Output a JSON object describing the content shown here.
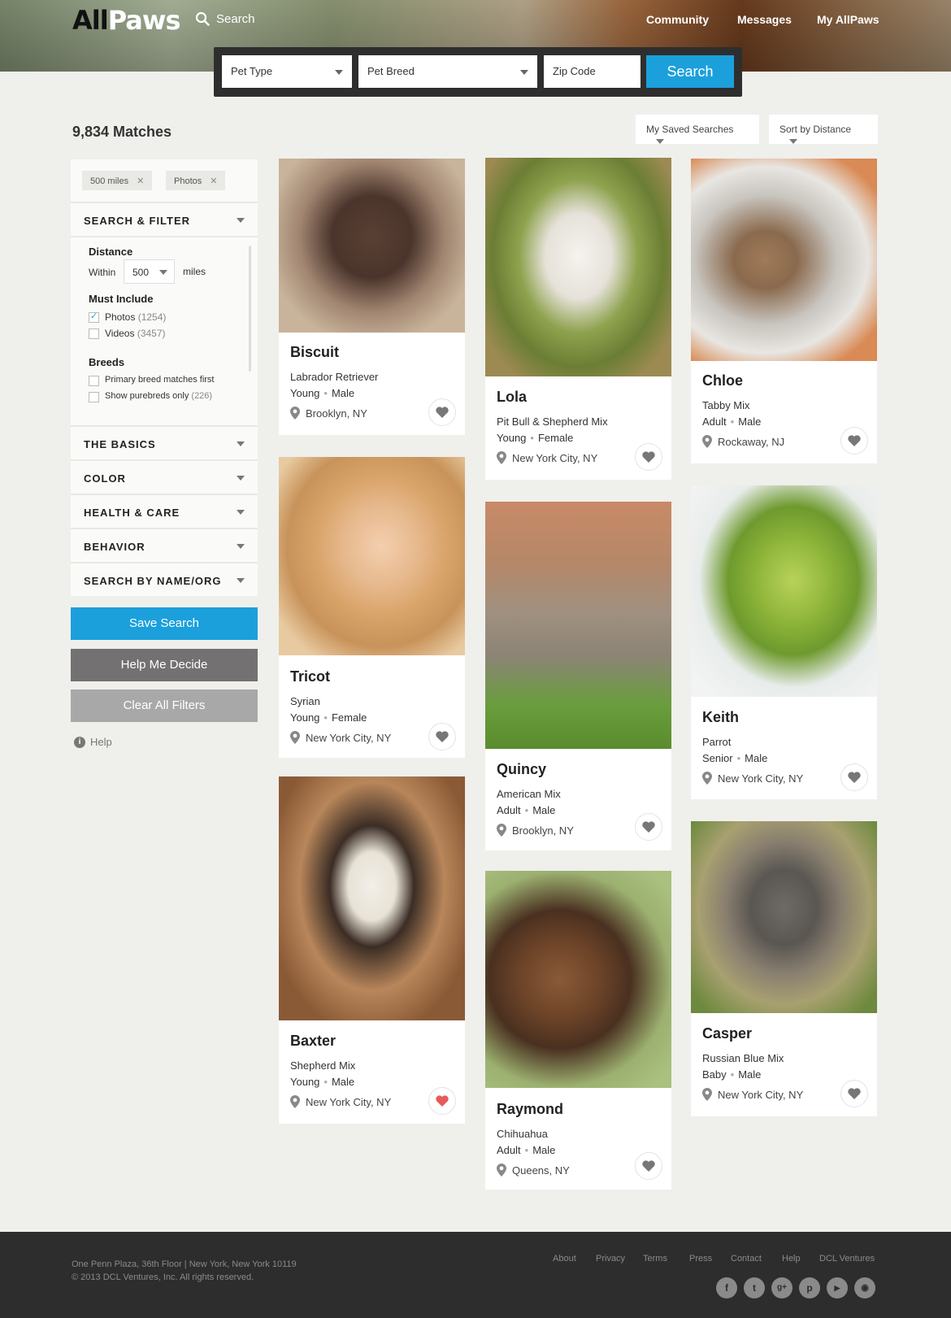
{
  "header": {
    "logo_part1": "All",
    "logo_part2": "Paws",
    "search_label": "Search",
    "nav": [
      "Community",
      "Messages",
      "My AllPaws"
    ]
  },
  "searchbar": {
    "pet_type": "Pet Type",
    "pet_breed": "Pet Breed",
    "zip_placeholder": "Zip Code",
    "search_button": "Search"
  },
  "results": {
    "matches": "9,834 Matches",
    "saved_searches": "My Saved Searches",
    "sort": "Sort by Distance"
  },
  "sidebar": {
    "chips": [
      "500 miles",
      "Photos"
    ],
    "search_filter": "SEARCH & FILTER",
    "distance_label": "Distance",
    "within": "Within",
    "distance_value": "500",
    "miles": "miles",
    "must_include": "Must Include",
    "photos": "Photos",
    "photos_count": "(1254)",
    "videos": "Videos",
    "videos_count": "(3457)",
    "breeds": "Breeds",
    "primary_breed": "Primary breed matches first",
    "purebreds": "Show purebreds only",
    "purebreds_count": "(226)",
    "sections": [
      "THE BASICS",
      "COLOR",
      "HEALTH & CARE",
      "BEHAVIOR",
      "SEARCH BY NAME/ORG"
    ],
    "save_search": "Save Search",
    "help_decide": "Help Me Decide",
    "clear_filters": "Clear All Filters",
    "help": "Help"
  },
  "pets": [
    {
      "name": "Biscuit",
      "breed": "Labrador Retriever",
      "age": "Young",
      "sex": "Male",
      "location": "Brooklyn, NY",
      "favorited": false
    },
    {
      "name": "Lola",
      "breed": "Pit Bull & Shepherd Mix",
      "age": "Young",
      "sex": "Female",
      "location": "New York City, NY",
      "favorited": false
    },
    {
      "name": "Chloe",
      "breed": "Tabby Mix",
      "age": "Adult",
      "sex": "Male",
      "location": "Rockaway, NJ",
      "favorited": false
    },
    {
      "name": "Tricot",
      "breed": "Syrian",
      "age": "Young",
      "sex": "Female",
      "location": "New York City, NY",
      "favorited": false
    },
    {
      "name": "Quincy",
      "breed": "American Mix",
      "age": "Adult",
      "sex": "Male",
      "location": "Brooklyn, NY",
      "favorited": false
    },
    {
      "name": "Keith",
      "breed": "Parrot",
      "age": "Senior",
      "sex": "Male",
      "location": "New York City, NY",
      "favorited": false
    },
    {
      "name": "Baxter",
      "breed": "Shepherd Mix",
      "age": "Young",
      "sex": "Male",
      "location": "New York City, NY",
      "favorited": true
    },
    {
      "name": "Raymond",
      "breed": "Chihuahua",
      "age": "Adult",
      "sex": "Male",
      "location": "Queens, NY",
      "favorited": false
    },
    {
      "name": "Casper",
      "breed": "Russian Blue Mix",
      "age": "Baby",
      "sex": "Male",
      "location": "New York City, NY",
      "favorited": false
    }
  ],
  "footer": {
    "address": "One Penn Plaza, 36th Floor | New York, New York 10119",
    "copyright": "© 2013 DCL Ventures, Inc. All rights reserved.",
    "links": [
      "About",
      "Privacy",
      "Terms",
      "Press",
      "Contact",
      "Help",
      "DCL Ventures"
    ],
    "social": [
      "facebook-icon",
      "twitter-icon",
      "google-plus-icon",
      "pinterest-icon",
      "youtube-icon",
      "instagram-icon"
    ]
  },
  "colors": {
    "accent": "#1ba0dc",
    "dark_button": "#737171",
    "light_button": "#a8a8a8",
    "heart_active": "#e85a5a",
    "footer": "#2d2d2d"
  }
}
